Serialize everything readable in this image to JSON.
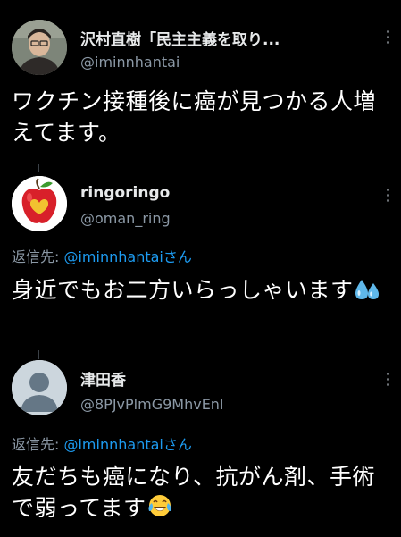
{
  "tweets": [
    {
      "name": "沢村直樹「民主主義を取り...",
      "handle": "@iminnhantai",
      "text": "ワクチン接種後に癌が見つかる人増えてます。"
    },
    {
      "name": "ringoringo",
      "handle": "@oman_ring",
      "reply_prefix": "返信先: ",
      "reply_mention": "@iminnhantaiさん",
      "text": "身近でもお二方いらっしゃいます"
    },
    {
      "name": "津田香",
      "handle": "@8PJvPlmG9MhvEnl",
      "reply_prefix": "返信先: ",
      "reply_mention": "@iminnhantaiさん",
      "text": "友だちも癌になり、抗がん剤、手術で弱ってます"
    }
  ],
  "icons": [
    "more-icon",
    "sweat-droplets-emoji",
    "tears-of-joy-emoji",
    "default-avatar-icon",
    "apple-heart-avatar"
  ],
  "colors": {
    "background": "#000000",
    "text": "#ffffff",
    "secondary": "#8b98a5",
    "link": "#1d9bf0"
  }
}
